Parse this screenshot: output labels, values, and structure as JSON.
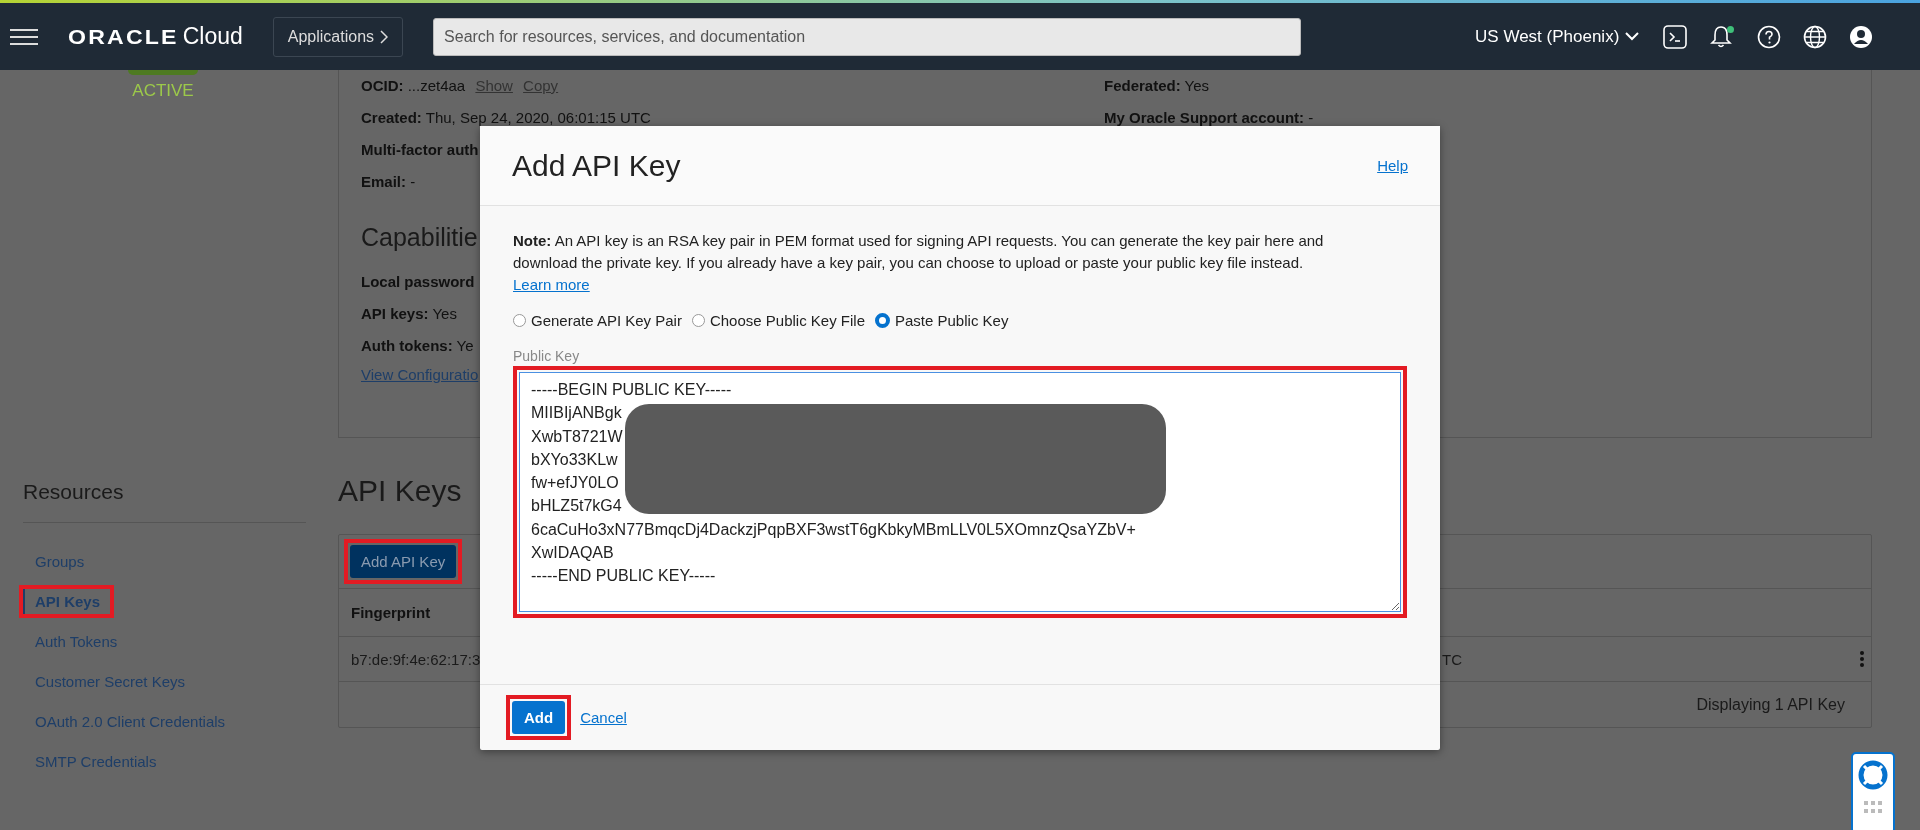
{
  "topbar": {
    "logo_brand": "ORACLE",
    "logo_product": "Cloud",
    "apps_button": "Applications",
    "search": {
      "placeholder": "Search for resources, services, and documentation"
    },
    "region": "US West (Phoenix)",
    "has_notification": true
  },
  "profile": {
    "status": "ACTIVE"
  },
  "details": {
    "left": [
      {
        "text": "**OCID:** ...zet4aa",
        "links": [
          "Show",
          "Copy"
        ]
      },
      {
        "text": "**Created:** Thu, Sep 24, 2020, 06:01:15 UTC"
      },
      {
        "text": "**Multi-factor auth**"
      },
      {
        "text": "**Email:** -"
      }
    ],
    "capabilities_heading": "Capabilitie",
    "capabilities": [
      {
        "text": "**Local password**"
      },
      {
        "text": "**API keys:** Yes"
      },
      {
        "text": "**Auth tokens:** Ye"
      }
    ],
    "view_link": "View Configuratio",
    "right": [
      {
        "text": "**Federated:** Yes"
      },
      {
        "text": "**My Oracle Support account:** -"
      }
    ]
  },
  "resources": {
    "title": "Resources",
    "items": [
      {
        "label": "Groups",
        "selected": false,
        "annotated": false
      },
      {
        "label": "API Keys",
        "selected": true,
        "annotated": true
      },
      {
        "label": "Auth Tokens",
        "selected": false,
        "annotated": false
      },
      {
        "label": "Customer Secret Keys",
        "selected": false,
        "annotated": false
      },
      {
        "label": "OAuth 2.0 Client Credentials",
        "selected": false,
        "annotated": false
      },
      {
        "label": "SMTP Credentials",
        "selected": false,
        "annotated": false
      }
    ]
  },
  "api_keys": {
    "title": "API Keys",
    "add_button": {
      "label": "Add API Key",
      "annotated": true
    },
    "columns": [
      "Fingerprint"
    ],
    "rows": [
      {
        "cells": [
          "b7:de:9f:4e:62:17:3",
          "TC"
        ]
      }
    ],
    "footer": "Displaying 1 API Key"
  },
  "modal": {
    "title": "Add API Key",
    "help": "Help",
    "note": {
      "text": "**Note:** An API key is an RSA key pair in PEM format used for signing API requests. You can generate the key pair here and download the private key. If you already have a key pair, you can choose to upload or paste your public key file instead.",
      "link": "Learn more"
    },
    "options": [
      {
        "label": "Generate API Key Pair",
        "selected": false
      },
      {
        "label": "Choose Public Key File",
        "selected": false
      },
      {
        "label": "Paste Public Key",
        "selected": true
      }
    ],
    "field": {
      "label": "Public Key",
      "annotated": true,
      "redacted": true,
      "lines": [
        "-----BEGIN PUBLIC KEY-----",
        "MIIBIjANBgk",
        "XwbT8721W",
        "bXYo33KLw",
        "fw+efJY0LO",
        "bHLZ5t7kG4",
        "6caCuHo3xN77BmqcDj4DackzjPqpBXF3wstT6gKbkyMBmLLV0L5XOmnzQsaYZbV+",
        "XwIDAQAB",
        "-----END PUBLIC KEY-----"
      ]
    },
    "add_button": {
      "label": "Add",
      "annotated": true
    },
    "cancel": "Cancel"
  }
}
